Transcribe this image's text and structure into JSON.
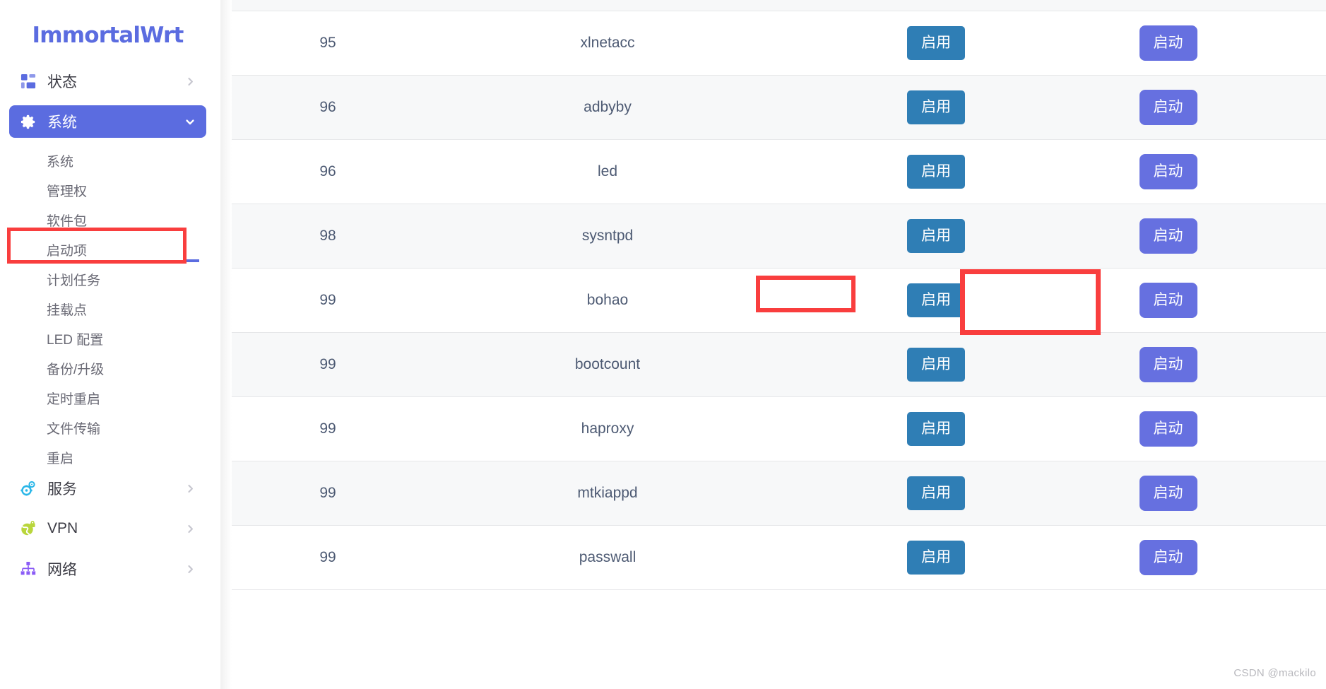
{
  "brand": {
    "name": "ImmortalWrt"
  },
  "sidebar": {
    "groups": [
      {
        "icon": "dashboard-icon",
        "label": "状态",
        "active": false,
        "expanded": false,
        "chevron": "chevron-right-icon"
      },
      {
        "icon": "gear-icon",
        "label": "系统",
        "active": true,
        "expanded": true,
        "chevron": "chevron-down-icon"
      }
    ],
    "system_children": [
      {
        "label": "系统"
      },
      {
        "label": "管理权"
      },
      {
        "label": "软件包"
      },
      {
        "label": "启动项"
      },
      {
        "label": "计划任务"
      },
      {
        "label": "挂载点"
      },
      {
        "label": "LED 配置"
      },
      {
        "label": "备份/升级"
      },
      {
        "label": "定时重启"
      },
      {
        "label": "文件传输"
      },
      {
        "label": "重启"
      }
    ],
    "groups_bottom": [
      {
        "icon": "gears-icon",
        "label": "服务",
        "chevron": "chevron-right-icon"
      },
      {
        "icon": "vpn-globe-lock-icon",
        "label": "VPN",
        "chevron": "chevron-right-icon"
      },
      {
        "icon": "network-icon",
        "label": "网络",
        "chevron": "chevron-right-icon"
      }
    ]
  },
  "table": {
    "buttons": {
      "enable": "启用",
      "start": "启动"
    },
    "rows": [
      {
        "start": "95",
        "name": "xlnetacc"
      },
      {
        "start": "96",
        "name": "adbyby"
      },
      {
        "start": "96",
        "name": "led"
      },
      {
        "start": "98",
        "name": "sysntpd"
      },
      {
        "start": "99",
        "name": "bohao"
      },
      {
        "start": "99",
        "name": "bootcount"
      },
      {
        "start": "99",
        "name": "haproxy"
      },
      {
        "start": "99",
        "name": "mtkiappd"
      },
      {
        "start": "99",
        "name": "passwall"
      }
    ]
  },
  "annotations": {
    "sidebar_target": "启动项",
    "row_target": "bohao",
    "button_target": "启用",
    "color": "#f93e3e"
  },
  "watermark": {
    "text": "CSDN @mackilo"
  },
  "colors": {
    "brand": "#5b6ce0",
    "active_nav": "#5b6ce0",
    "enable_button": "#2f7eb5",
    "start_button": "#6670e0",
    "annotation": "#f93e3e",
    "row_alt": "#f7f8f9"
  }
}
